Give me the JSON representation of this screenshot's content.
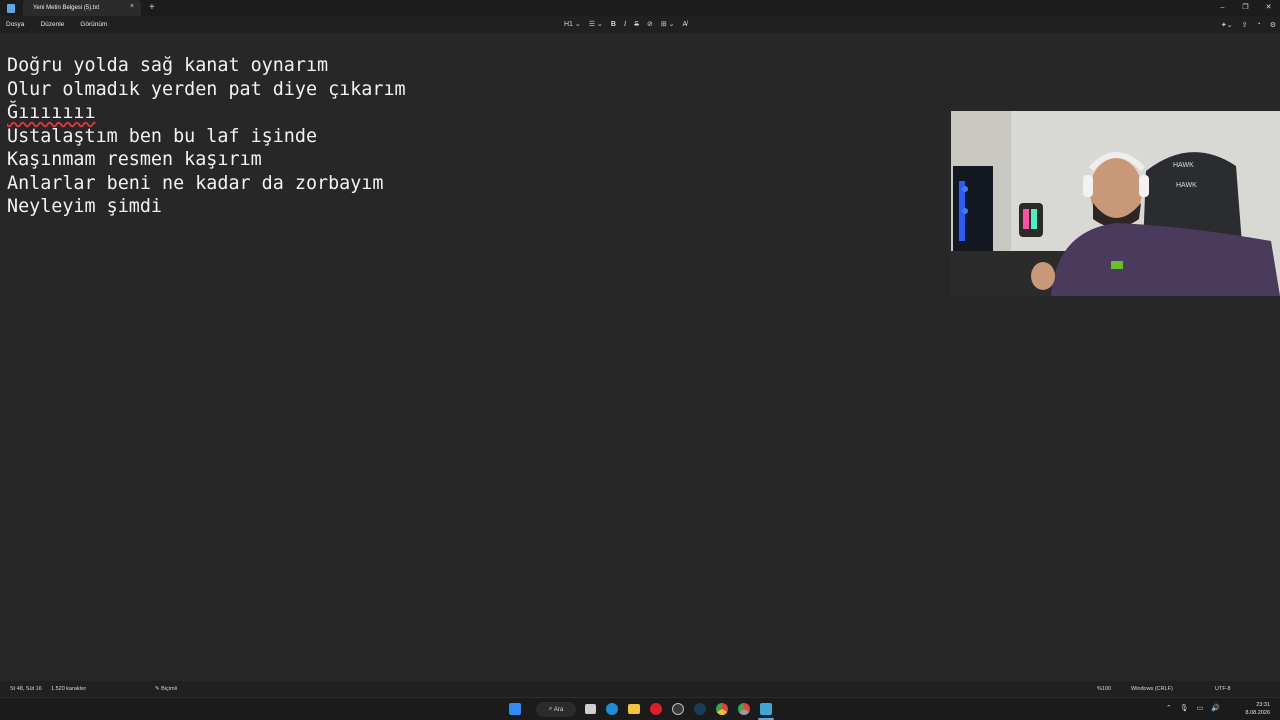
{
  "window": {
    "tab_title": "Yeni Metin Belgesi (5).txt",
    "tab_close": "×",
    "new_tab": "+",
    "minimize": "–",
    "maximize": "❐",
    "close": "✕"
  },
  "menu": {
    "file": "Dosya",
    "edit": "Düzenle",
    "view": "Görünüm"
  },
  "toolbar": {
    "heading": "H1 ⌄",
    "list": "☰ ⌄",
    "bold": "B",
    "italic": "I",
    "strike": "S",
    "link": "⊘",
    "table": "⊞ ⌄",
    "clear_format": "A̸",
    "copilot_icon": "sparkle-icon",
    "settings_icon": "gear-icon"
  },
  "document": {
    "lines": [
      "Doğru yolda sağ kanat oynarım",
      "Olur olmadık yerden pat diye çıkarım",
      "Ğııııııı",
      "Ustalaştım ben bu laf işinde",
      "Kaşınmam resmen kaşırım",
      "Anlarlar beni ne kadar da zorbayım",
      "Neyleyim şimdi"
    ]
  },
  "status": {
    "position": "St 48, Süt 16",
    "characters": "1.520 karakter",
    "format_mode": "Biçimli",
    "zoom": "%100",
    "line_ending": "Windows (CRLF)",
    "encoding": "UTF-8"
  },
  "taskbar": {
    "search_label": "Ara",
    "time": "23:31",
    "date": "8.08.2026",
    "apps": [
      "start-icon",
      "search-icon",
      "task-view-icon",
      "edge-icon",
      "file-explorer-icon",
      "opera-icon",
      "obs-icon",
      "steam-icon",
      "chrome-icon",
      "chrome-alt-icon",
      "notepad-icon"
    ]
  },
  "colors": {
    "background": "#272727",
    "text": "#f2f2f2",
    "spellcheck": "#e0393e"
  }
}
